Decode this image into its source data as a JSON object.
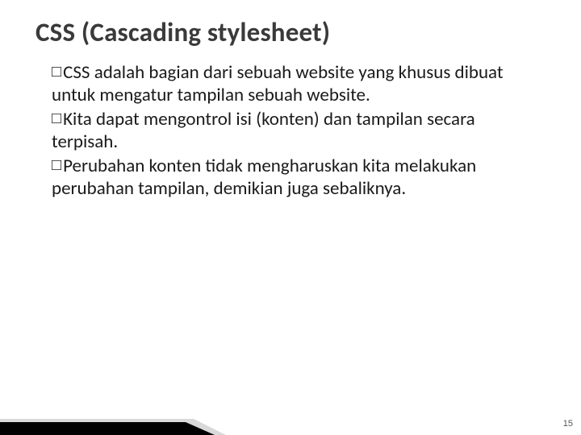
{
  "title": "CSS (Cascading stylesheet)",
  "bullets": [
    "CSS adalah bagian dari sebuah website yang khusus dibuat untuk mengatur tampilan sebuah website.",
    "Kita dapat mengontrol isi (konten) dan tampilan secara terpisah.",
    "Perubahan konten tidak mengharuskan kita melakukan perubahan tampilan, demikian juga sebaliknya."
  ],
  "page_number": "15"
}
